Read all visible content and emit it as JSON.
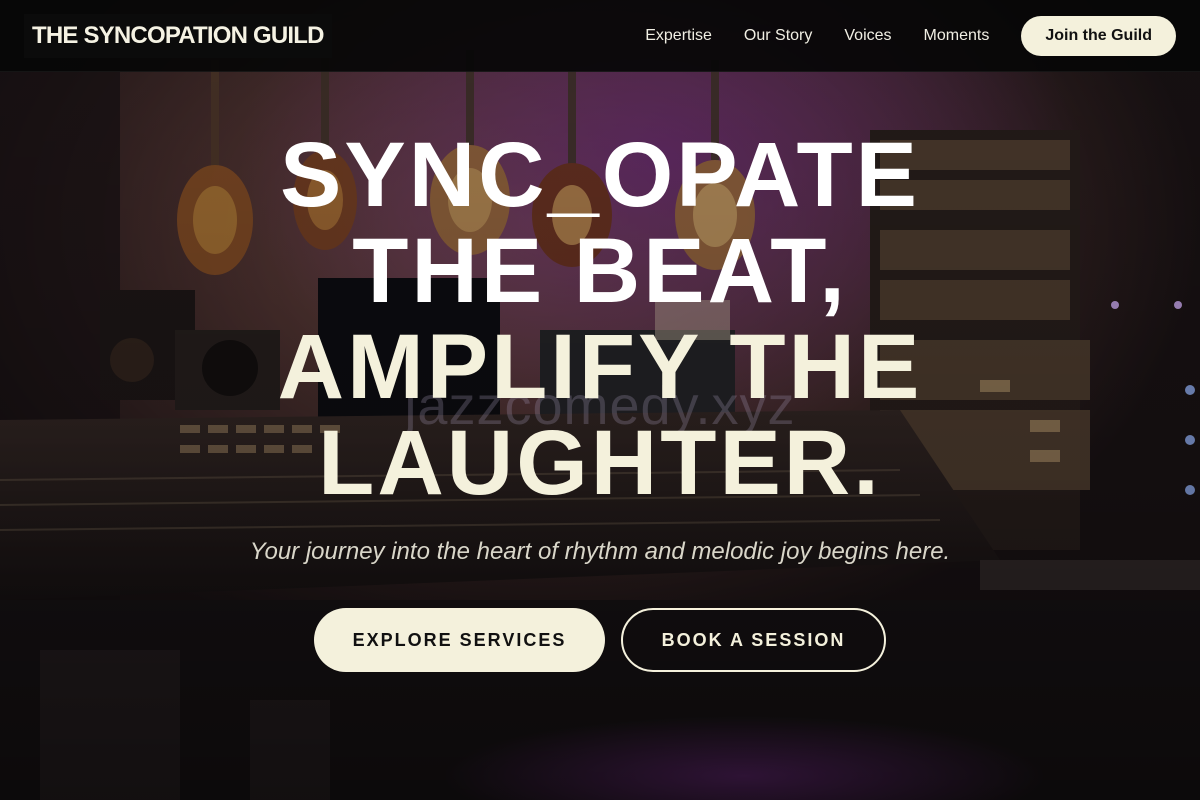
{
  "nav": {
    "brand": "THE SYNCOPATION GUILD",
    "links": [
      "Expertise",
      "Our Story",
      "Voices",
      "Moments"
    ],
    "cta": "Join the Guild"
  },
  "hero": {
    "title_lines": [
      "SYNC_OPATE",
      "THE BEAT,",
      "AMPLIFY THE",
      "LAUGHTER."
    ],
    "watermark": "jazzcomedy.xyz",
    "tagline": "Your journey into the heart of rhythm and melodic joy begins here.",
    "primary_button": "EXPLORE SERVICES",
    "secondary_button": "BOOK A SESSION"
  },
  "colors": {
    "accent_cream": "#f4f1dc",
    "nav_background": "#060606",
    "studio_purple": "#6a2a7a"
  },
  "background": {
    "image": "recording studio with guitars and mixing console"
  }
}
